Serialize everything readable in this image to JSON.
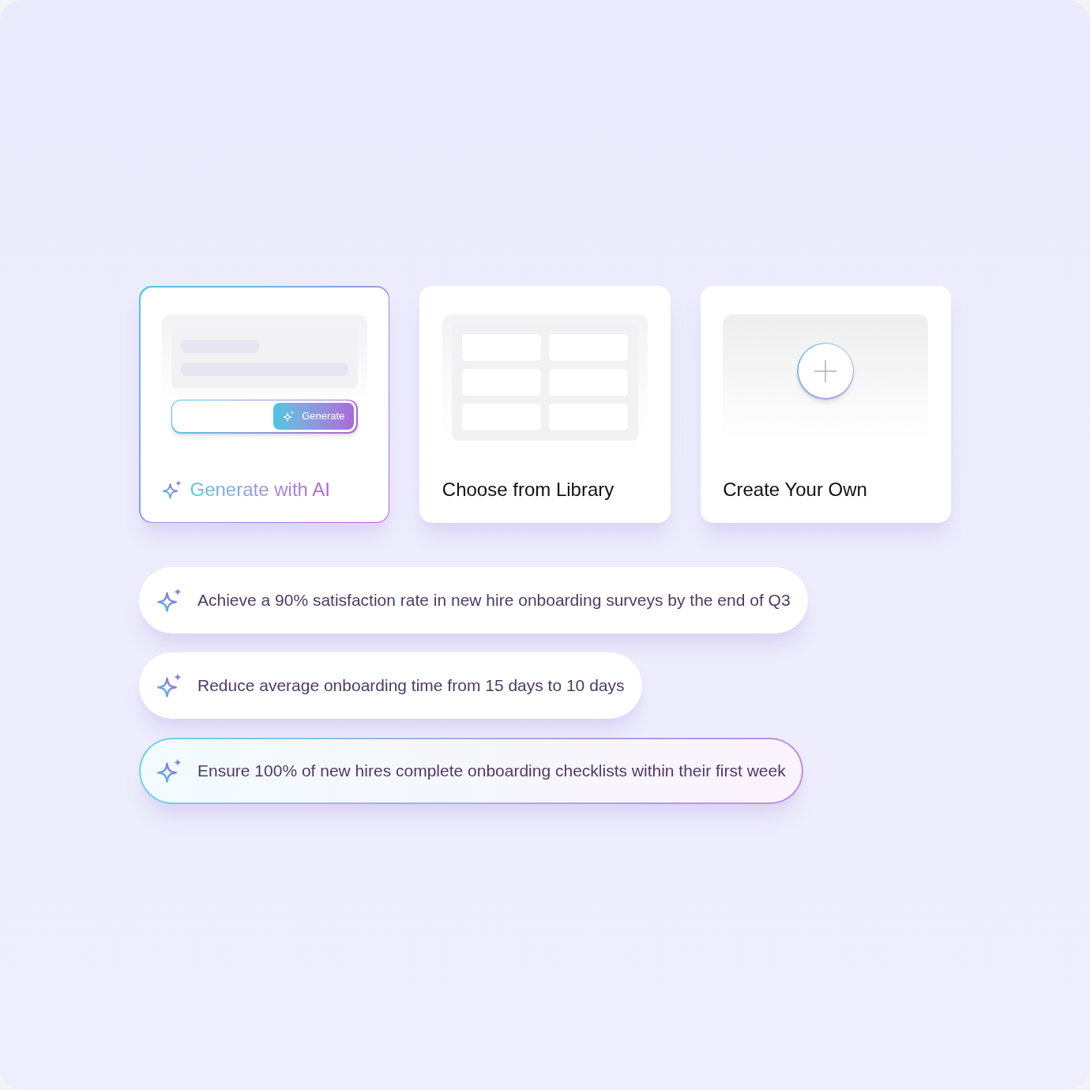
{
  "options": [
    {
      "kind": "ai",
      "title": "Generate with AI",
      "selected": true,
      "button": "Generate"
    },
    {
      "kind": "library",
      "title": "Choose from Library",
      "selected": false
    },
    {
      "kind": "custom",
      "title": "Create Your Own",
      "selected": false
    }
  ],
  "goals": [
    {
      "text": "Achieve a 90% satisfaction rate in new hire onboarding surveys by the end of Q3",
      "selected": false
    },
    {
      "text": "Reduce average onboarding time from 15 days to 10 days",
      "selected": false
    },
    {
      "text": "Ensure 100% of new hires complete onboarding checklists within their first week",
      "selected": true
    }
  ]
}
